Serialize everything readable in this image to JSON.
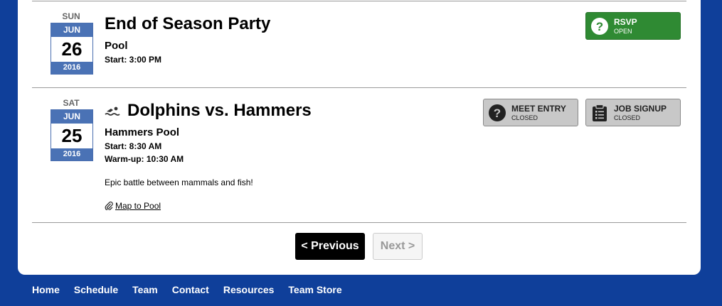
{
  "events": [
    {
      "dow": "SUN",
      "month": "JUN",
      "day": "26",
      "year": "2016",
      "title": "End of Season Party",
      "location": "Pool",
      "start": "Start: 3:00 PM",
      "rsvp": {
        "label": "RSVP",
        "status": "OPEN",
        "icon": "question-circle-icon",
        "color": "#2f8a33"
      }
    },
    {
      "dow": "SAT",
      "month": "JUN",
      "day": "25",
      "year": "2016",
      "title": "Dolphins vs. Hammers",
      "title_icon": "swimmer-icon",
      "location": "Hammers Pool",
      "start": "Start: 8:30 AM",
      "warmup": "Warm-up: 10:30 AM",
      "description": "Epic battle between mammals and fish!",
      "map_link": "Map to Pool",
      "meet_entry": {
        "label": "MEET ENTRY",
        "status": "CLOSED",
        "icon": "question-circle-icon"
      },
      "job_signup": {
        "label": "JOB SIGNUP",
        "status": "CLOSED",
        "icon": "clipboard-icon"
      }
    }
  ],
  "pager": {
    "previous": "< Previous",
    "next": "Next >"
  },
  "footer_nav": [
    "Home",
    "Schedule",
    "Team",
    "Contact",
    "Resources",
    "Team Store"
  ],
  "colors": {
    "background": "#0f3f9a",
    "calendar": "#4a72b5",
    "open": "#2f8a33",
    "closed": "#c8c8c8"
  }
}
